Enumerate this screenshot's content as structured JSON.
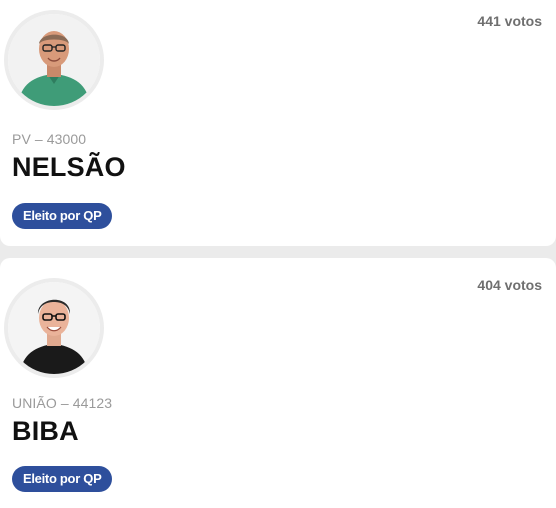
{
  "candidates": [
    {
      "votes": "441 votos",
      "party": "PV – 43000",
      "name": "NELSÃO",
      "status": "Eleito por QP",
      "avatar": "candidate-photo-glasses-green-shirt"
    },
    {
      "votes": "404 votos",
      "party": "UNIÃO – 44123",
      "name": "BIBA",
      "status": "Eleito por QP",
      "avatar": "candidate-photo-glasses-black-shirt"
    }
  ],
  "colors": {
    "badge": "#2e4f9c",
    "name": "#111111",
    "muted": "#9a9a9a",
    "votes": "#6f6f6f"
  }
}
